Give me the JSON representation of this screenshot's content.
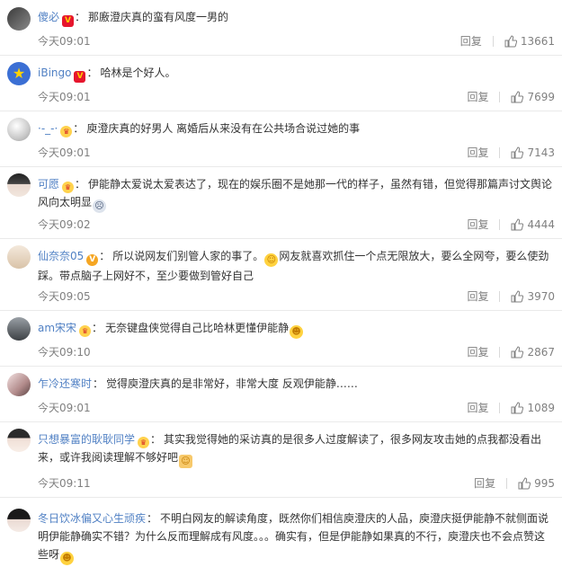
{
  "comments": [
    {
      "user": "傻必",
      "badge": "V",
      "text": "那廒澄庆真的蛮有风度一男的",
      "time": "今天09:01",
      "reply": "回复",
      "likes": "13661"
    },
    {
      "user": "iBingo",
      "badge": "V",
      "text": "哈林是个好人。",
      "time": "今天09:01",
      "reply": "回复",
      "likes": "7699"
    },
    {
      "user": "·-_-·",
      "badge": "crown",
      "text": "庾澄庆真的好男人 离婚后从来没有在公共场合说过她的事",
      "time": "今天09:01",
      "reply": "回复",
      "likes": "7143"
    },
    {
      "user": "可愿",
      "badge": "crown",
      "text": "伊能静太爱说太爱表达了，现在的娱乐圈不是她那一代的样子，虽然有错，但觉得那篇声讨文舆论风向太明显",
      "time": "今天09:02",
      "reply": "回复",
      "likes": "4444"
    },
    {
      "user": "仙奈奈05",
      "badge": "V",
      "text": "所以说网友们别管人家的事了。",
      "text2": "网友就喜欢抓住一个点无限放大，要么全网夸，要么使劲踩。带点脑子上网好不，至少要做到管好自己",
      "time": "今天09:05",
      "reply": "回复",
      "likes": "3970"
    },
    {
      "user": "am宋宋",
      "badge": "crown",
      "text": "无奈键盘侠觉得自己比哈林更懂伊能静",
      "time": "今天09:10",
      "reply": "回复",
      "likes": "2867"
    },
    {
      "user": "乍冷还寒时",
      "badge": "",
      "text": "觉得庾澄庆真的是非常好，非常大度 反观伊能静……",
      "time": "今天09:01",
      "reply": "回复",
      "likes": "1089"
    },
    {
      "user": "只想暴富的耿耿同学",
      "badge": "crown",
      "text": "其实我觉得她的采访真的是很多人过度解读了，很多网友攻击她的点我都没看出来，或许我阅读理解不够好吧",
      "time": "今天09:11",
      "reply": "回复",
      "likes": "995"
    },
    {
      "user": "冬日饮冰偏又心生顽疾",
      "badge": "",
      "text": "不明白网友的解读角度，既然你们相信庾澄庆的人品，庾澄庆挺伊能静不就侧面说明伊能静确实不错？为什么反而理解成有风度。。。确实有，但是伊能静如果真的不行，庾澄庆也不会点赞这些呀",
      "time": "",
      "reply": "",
      "likes": ""
    }
  ]
}
